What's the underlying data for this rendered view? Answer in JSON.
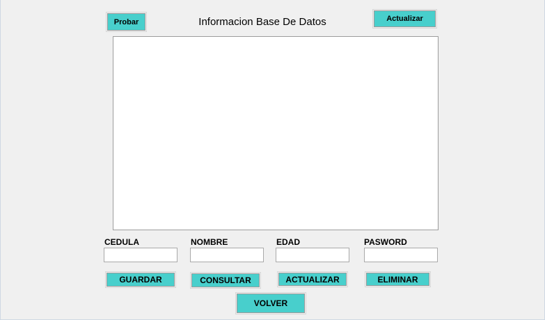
{
  "header": {
    "probar_label": "Probar",
    "title": "Informacion Base De Datos",
    "actualizar_label": "Actualizar"
  },
  "grid": {
    "rows": []
  },
  "fields": [
    {
      "label": "CEDULA",
      "value": ""
    },
    {
      "label": "NOMBRE",
      "value": ""
    },
    {
      "label": "EDAD",
      "value": ""
    },
    {
      "label": "PASWORD",
      "value": ""
    }
  ],
  "actions": {
    "guardar_label": "GUARDAR",
    "consultar_label": "CONSULTAR",
    "actualizar_label": "ACTUALIZAR",
    "eliminar_label": "ELIMINAR",
    "volver_label": "VOLVER"
  },
  "colors": {
    "button": "#48cfcc",
    "background": "#f0f0f0"
  }
}
